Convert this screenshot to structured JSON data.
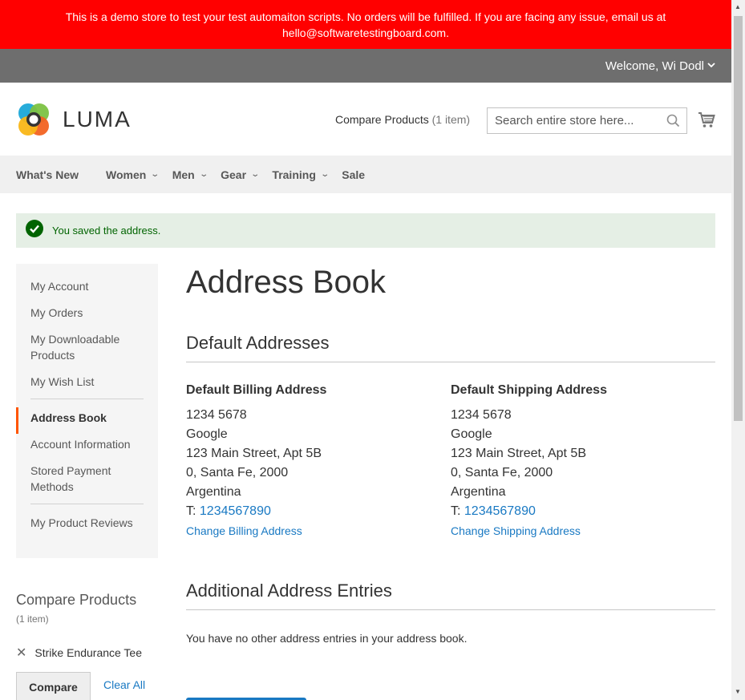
{
  "demo_notice": "This is a demo store to test your test automaiton scripts. No orders will be fulfilled. If you are facing any issue, email us at hello@softwaretestingboard.com.",
  "welcome": "Welcome, Wi Dodl",
  "logo_text": "LUMA",
  "compare_header": {
    "label": "Compare Products",
    "count": "(1 item)"
  },
  "search": {
    "placeholder": "Search entire store here..."
  },
  "nav": [
    "What's New",
    "Women",
    "Men",
    "Gear",
    "Training",
    "Sale"
  ],
  "success_message": "You saved the address.",
  "sidebar": {
    "group1": [
      "My Account",
      "My Orders",
      "My Downloadable Products",
      "My Wish List"
    ],
    "current": "Address Book",
    "group2": [
      "Account Information",
      "Stored Payment Methods"
    ],
    "group3": [
      "My Product Reviews"
    ]
  },
  "compare_side": {
    "title": "Compare Products",
    "count": "(1 item)",
    "product": "Strike Endurance Tee",
    "compare_button": "Compare",
    "clear_all": "Clear All"
  },
  "page_title": "Address Book",
  "default_section": "Default Addresses",
  "billing": {
    "title": "Default Billing Address",
    "lines": [
      "1234 5678",
      "Google",
      "123 Main Street, Apt 5B",
      "0, Santa Fe, 2000",
      "Argentina"
    ],
    "phone_prefix": "T: ",
    "phone": "1234567890",
    "change": "Change Billing Address"
  },
  "shipping": {
    "title": "Default Shipping Address",
    "lines": [
      "1234 5678",
      "Google",
      "123 Main Street, Apt 5B",
      "0, Santa Fe, 2000",
      "Argentina"
    ],
    "phone_prefix": "T: ",
    "phone": "1234567890",
    "change": "Change Shipping Address"
  },
  "additional_section": "Additional Address Entries",
  "no_entries": "You have no other address entries in your address book.",
  "colors": {
    "demo_bar": "#ff0000",
    "link": "#1979c3",
    "accent": "#ff5501",
    "success": "#006400"
  }
}
